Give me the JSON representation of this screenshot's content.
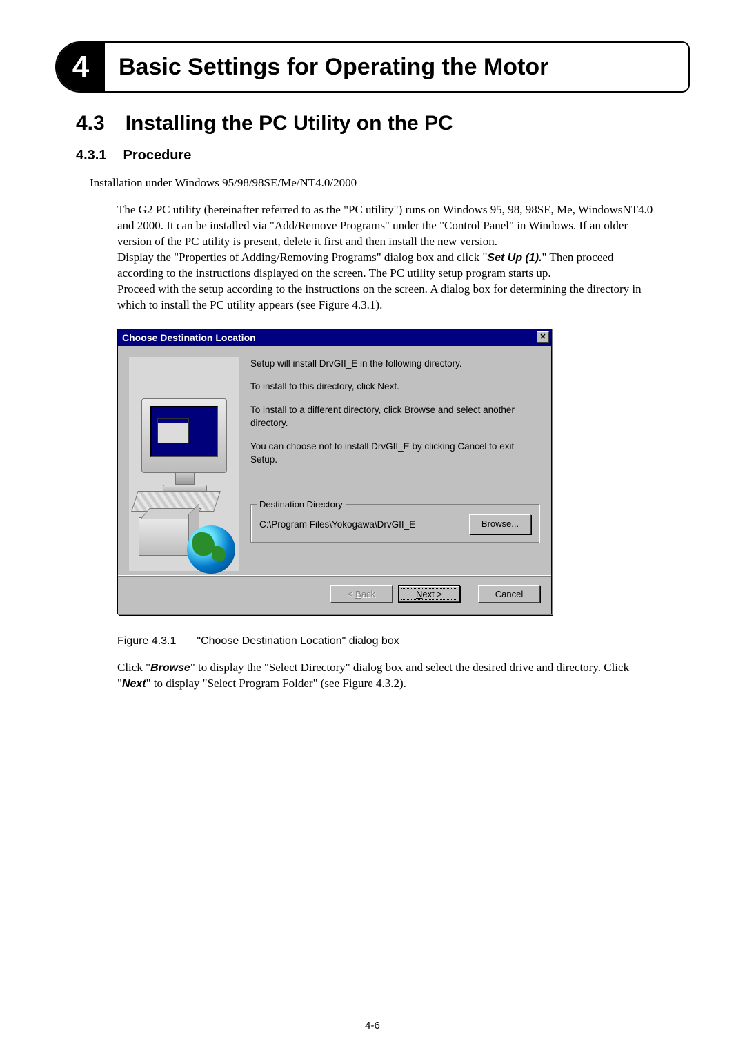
{
  "chapter": {
    "number": "4",
    "title": "Basic Settings for Operating the Motor"
  },
  "section": {
    "number": "4.3",
    "title": "Installing the PC Utility on the PC"
  },
  "subsection": {
    "number": "4.3.1",
    "title": "Procedure"
  },
  "install_header": "Installation under Windows 95/98/98SE/Me/NT4.0/2000",
  "para1a": "The G2 PC utility (hereinafter referred to as the \"PC utility\") runs on Windows 95, 98, 98SE, Me, WindowsNT4.0 and 2000. It can be installed via \"Add/Remove Programs\" under the \"Control Panel\" in Windows. If an older version of the PC utility is present, delete it first and then install the new version.",
  "para1b_pre": "Display the \"Properties of Adding/Removing Programs\" dialog box and click \"",
  "para1b_bold": "Set Up (1).",
  "para1b_post": "\" Then proceed according to the instructions displayed on the screen. The PC utility setup program starts up.",
  "para1c": "Proceed with the setup according to the instructions on the screen. A dialog box for determining the directory in which to install the PC utility appears (see Figure 4.3.1).",
  "dialog": {
    "title": "Choose Destination Location",
    "line1": "Setup will install DrvGII_E in the following directory.",
    "line2": "To install to this directory, click Next.",
    "line3": "To install to a different directory, click Browse and select another directory.",
    "line4": "You can choose not to install DrvGII_E by clicking Cancel to exit Setup.",
    "dest_legend": "Destination Directory",
    "dest_path": "C:\\Program Files\\Yokogawa\\DrvGII_E",
    "browse_pre": "B",
    "browse_u": "r",
    "browse_post": "owse...",
    "back_pre": "< ",
    "back_u": "B",
    "back_post": "ack",
    "next_u": "N",
    "next_post": "ext >",
    "cancel": "Cancel"
  },
  "figure": {
    "number": "Figure 4.3.1",
    "caption": "\"Choose Destination Location\" dialog box"
  },
  "para2_pre": "Click \"",
  "para2_b1": "Browse",
  "para2_mid": "\" to display the \"Select Directory\" dialog box and select the desired drive and directory. Click \"",
  "para2_b2": "Next",
  "para2_post": "\" to display \"Select Program Folder\" (see Figure 4.3.2).",
  "page_num": "4-6"
}
